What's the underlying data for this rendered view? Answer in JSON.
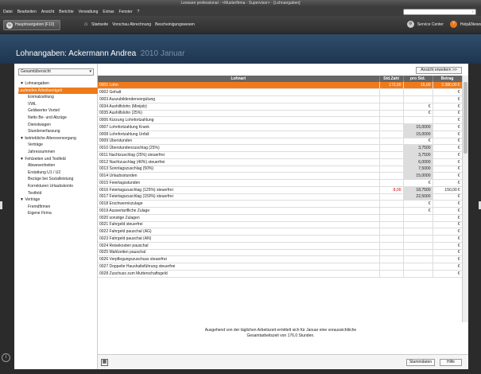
{
  "window": {
    "title": "Lexware professional - <Musterfirma - Supervisor> - [Lohnangaben]"
  },
  "menu": [
    "Datei",
    "Bearbeiten",
    "Ansicht",
    "Berichte",
    "Verwaltung",
    "Extras",
    "Fenster",
    "?"
  ],
  "toolbar": {
    "hauptnav": "Hauptnavigation [F10]",
    "items": [
      "Startseite",
      "Vorschau Abrechnung",
      "Bescheinigungswesen"
    ],
    "service_center": "Service Center",
    "help": "Help&News"
  },
  "header": {
    "title": "Lohnangaben: Ackermann Andrea",
    "period": "2010  Januar"
  },
  "left": {
    "dropdown": "Gesamtübersicht",
    "nav": [
      {
        "type": "grp",
        "label": "Lohnangaben"
      },
      {
        "type": "sel",
        "label": "Laufendes Arbeitsentgelt"
      },
      {
        "type": "itm",
        "label": "Einmalzahlung"
      },
      {
        "type": "itm",
        "label": "VWL"
      },
      {
        "type": "itm",
        "label": "Geldwerter Vorteil"
      },
      {
        "type": "itm",
        "label": "Netto Be- und Abzüge"
      },
      {
        "type": "itm",
        "label": "Dienstwagen"
      },
      {
        "type": "itm",
        "label": "Stundenerfassung"
      },
      {
        "type": "grp",
        "label": "betriebliche Altersversorgung"
      },
      {
        "type": "itm",
        "label": "Verträge"
      },
      {
        "type": "itm",
        "label": "Jahressummen"
      },
      {
        "type": "grp",
        "label": "Fehlzeiten und Textfeld"
      },
      {
        "type": "itm",
        "label": "Abwesenheiten"
      },
      {
        "type": "itm",
        "label": "Erstattung U1 / U2"
      },
      {
        "type": "itm",
        "label": "Bezüge bei Sozialleistung"
      },
      {
        "type": "itm",
        "label": "Korrekturen Urlaubskonto"
      },
      {
        "type": "itm",
        "label": "Textfeld"
      },
      {
        "type": "grp",
        "label": "Verträge"
      },
      {
        "type": "itm",
        "label": "Fremdfirmen"
      },
      {
        "type": "itm",
        "label": "Eigene Firma"
      }
    ]
  },
  "table": {
    "ansicht_button": "Ansicht erweitern >>",
    "headers": [
      "Lohnart",
      "Std.Zahl",
      "pro Std.",
      "Betrag"
    ],
    "rows": [
      {
        "name": "0001 Lohn",
        "std": "172,00",
        "pro": "15,00",
        "betrag": "2.380,00",
        "cur": "€",
        "hi": true
      },
      {
        "name": "0002 Gehalt",
        "std": "",
        "pro": "",
        "betrag": "",
        "cur": "€"
      },
      {
        "name": "0003 Auszubildendenvergütung",
        "std": "",
        "pro": "",
        "betrag": "",
        "cur": "€"
      },
      {
        "name": "0034 Aushilfslohn (Minijob)",
        "std": "",
        "pro": "€",
        "betrag": "",
        "cur": "€"
      },
      {
        "name": "0035 Aushilfslohn (25%)",
        "std": "",
        "pro": "€",
        "betrag": "",
        "cur": "€"
      },
      {
        "name": "0006 Kürzung Lohnfortzahlung",
        "std": "",
        "pro": "",
        "betrag": "",
        "cur": "€"
      },
      {
        "name": "0007 Lohnfortzahlung Krank",
        "std": "",
        "pro": "15,0000",
        "betrag": "",
        "cur": "€"
      },
      {
        "name": "0008 Lohnfortzahlung Unfall",
        "std": "",
        "pro": "15,0000",
        "betrag": "",
        "cur": "€"
      },
      {
        "name": "0009 Überstunden",
        "std": "",
        "pro": "€",
        "betrag": "",
        "cur": "€"
      },
      {
        "name": "0010 Überstundenzuschlag (25%)",
        "std": "",
        "pro": "3,7500",
        "betrag": "",
        "cur": "€"
      },
      {
        "name": "0011 Nachtzuschlag (25%) steuerfrei",
        "std": "",
        "pro": "3,7500",
        "betrag": "",
        "cur": "€"
      },
      {
        "name": "0012 Nachtzuschlag (40%) steuerfrei",
        "std": "",
        "pro": "6,0000",
        "betrag": "",
        "cur": "€"
      },
      {
        "name": "0013 Sonntagszuschlag (50%)",
        "std": "",
        "pro": "7,5000",
        "betrag": "",
        "cur": "€"
      },
      {
        "name": "0014 Urlaubsstunden",
        "std": "",
        "pro": "15,0000",
        "betrag": "",
        "cur": "€"
      },
      {
        "name": "0015 Feiertagsstunden",
        "std": "",
        "pro": "€",
        "betrag": "",
        "cur": "€"
      },
      {
        "name": "0016 Feiertagszuschlag (125%) steuerfrei",
        "std": "8,00",
        "pro": "18,7500",
        "betrag": "150,00",
        "cur": "€",
        "red": true
      },
      {
        "name": "0017 Feiertagszuschlag (150%) steuerfrei",
        "std": "",
        "pro": "22,5000",
        "betrag": "",
        "cur": "€"
      },
      {
        "name": "0018 Erschwerniszulage",
        "std": "",
        "pro": "€",
        "betrag": "",
        "cur": "€"
      },
      {
        "name": "0019 Aussertarifliche Zulage",
        "std": "",
        "pro": "€",
        "betrag": "",
        "cur": "€"
      },
      {
        "name": "0020 sonstige Zulagen",
        "std": "",
        "pro": "",
        "betrag": "",
        "cur": "€"
      },
      {
        "name": "0021 Fahrgeld steuerfrei",
        "std": "",
        "pro": "",
        "betrag": "",
        "cur": "€"
      },
      {
        "name": "0022 Fahrgeld pauschal (AG)",
        "std": "",
        "pro": "",
        "betrag": "",
        "cur": "€"
      },
      {
        "name": "0023 Fahrgeld pauschal (AN)",
        "std": "",
        "pro": "",
        "betrag": "",
        "cur": "€"
      },
      {
        "name": "0024 Reisekosten pauschal",
        "std": "",
        "pro": "",
        "betrag": "",
        "cur": "€"
      },
      {
        "name": "0025 Mahlzeiten pauschal",
        "std": "",
        "pro": "",
        "betrag": "",
        "cur": "€"
      },
      {
        "name": "0026 Verpflegungszuschuss steuerfrei",
        "std": "",
        "pro": "",
        "betrag": "",
        "cur": "€"
      },
      {
        "name": "0027 Doppelte Haushaltsführung steuerfrei",
        "std": "",
        "pro": "",
        "betrag": "",
        "cur": "€"
      },
      {
        "name": "0028 Zuschuss zum Mutterschaftsgeld",
        "std": "",
        "pro": "",
        "betrag": "",
        "cur": "€"
      }
    ]
  },
  "footnote": "Ausgehend von der täglichen Arbeitszeit ermittelt sich für Januar eine voraussichtliche Gesamtarbeitszeit von 176,0 Stunden.",
  "buttons": {
    "stammdaten": "Stammdaten",
    "hilfe": "Hilfe"
  }
}
